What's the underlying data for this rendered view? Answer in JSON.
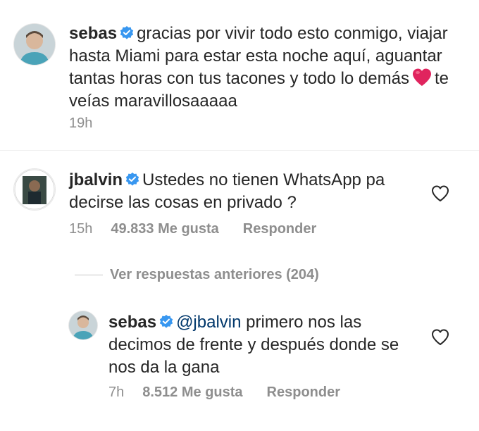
{
  "comment1": {
    "username": "sebas",
    "text_before_emoji": "gracias por vivir todo esto conmigo, viajar hasta Miami para estar esta noche aquí, aguantar tantas horas con tus tacones y todo lo demás",
    "emoji": "red-heart",
    "text_after_emoji": "te veías maravillosaaaaa",
    "time": "19h"
  },
  "comment2": {
    "username": "jbalvin",
    "text": "Ustedes no tienen WhatsApp pa decirse las cosas en privado ?",
    "time": "15h",
    "likes": "49.833 Me gusta",
    "reply_label": "Responder"
  },
  "view_replies": "Ver respuestas anteriores (204)",
  "reply": {
    "username": "sebas",
    "mention": "@jbalvin",
    "text": "primero nos las decimos de frente y después donde se nos da la gana",
    "time": "7h",
    "likes": "8.512 Me gusta",
    "reply_label": "Responder"
  },
  "colors": {
    "text": "#262626",
    "meta": "#8e8e8e",
    "verified": "#3897f0",
    "mention": "#00376b",
    "heart_emoji": "#e0245e"
  }
}
